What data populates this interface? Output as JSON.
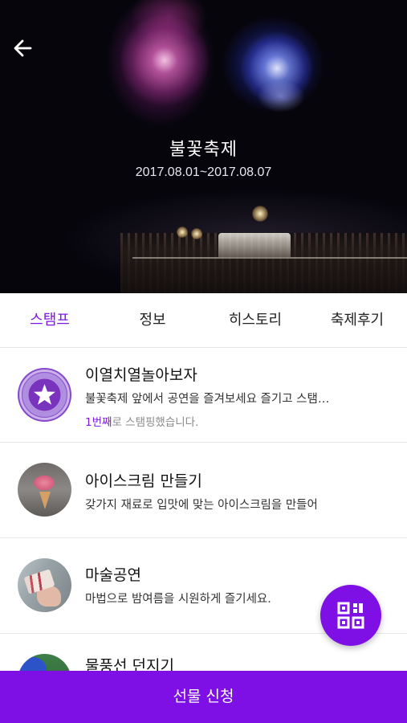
{
  "festival": {
    "title": "불꽃축제",
    "dates": "2017.08.01~2017.08.07"
  },
  "nav": {
    "back_icon": "arrow-left-icon"
  },
  "tabs": [
    {
      "label": "스탬프",
      "active": true
    },
    {
      "label": "정보",
      "active": false
    },
    {
      "label": "히스토리",
      "active": false
    },
    {
      "label": "축제후기",
      "active": false
    }
  ],
  "stamps": [
    {
      "title": "이열치열놀아보자",
      "description": "불꽃축제 앞에서 공연을 즐겨보세요 즐기고 스탬…",
      "status_highlight": "1번째",
      "status_rest": "로 스탬핑했습니다.",
      "thumb_icon": "star-stamp-badge-icon"
    },
    {
      "title": "아이스크림 만들기",
      "description": "갖가지 재료로 입맛에 맞는 아이스크림을 만들어",
      "thumb_icon": "ice-cream-photo"
    },
    {
      "title": "마술공연",
      "description": "마법으로 밤여름을 시원하게 즐기세요.",
      "thumb_icon": "playing-cards-photo"
    },
    {
      "title": "물풍선 던지기",
      "description": "",
      "thumb_icon": "water-balloon-photo"
    }
  ],
  "fab": {
    "icon": "qr-code-icon"
  },
  "bottom_bar": {
    "label": "선물 신청"
  },
  "colors": {
    "accent": "#7e10e6",
    "active_tab": "#7d18e0",
    "divider": "#e7e7e7"
  }
}
